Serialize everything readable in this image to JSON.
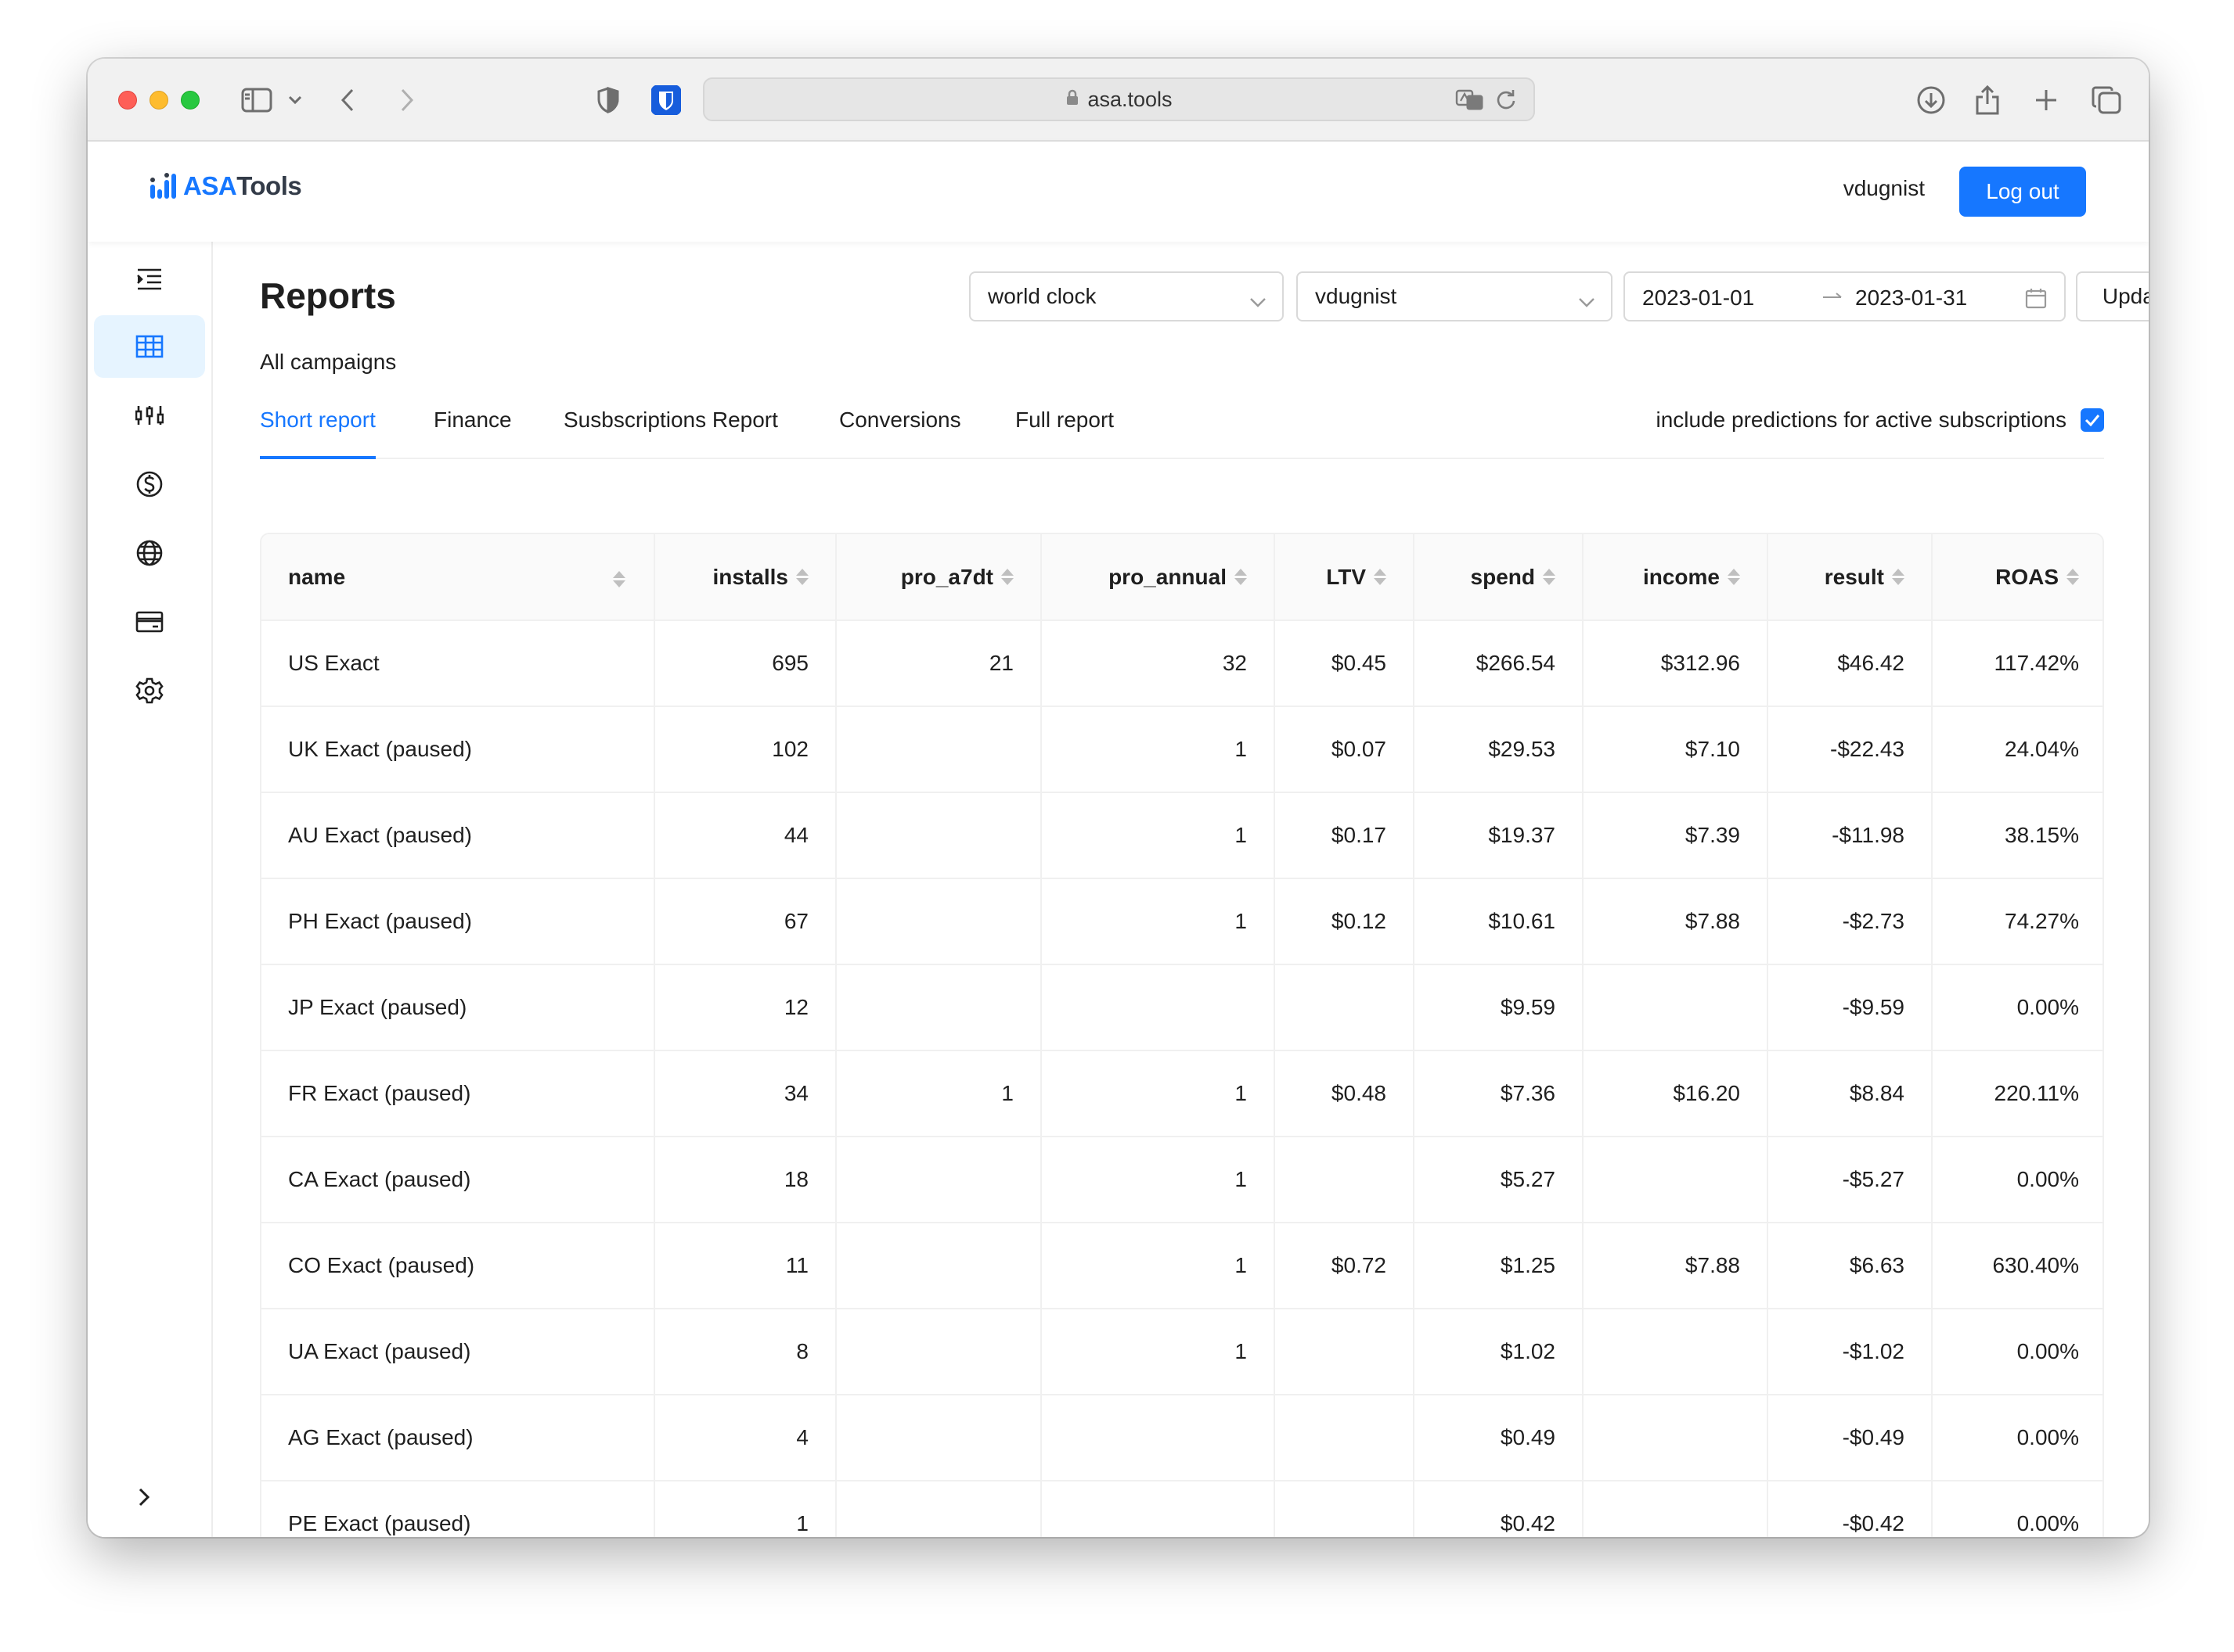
{
  "browser": {
    "url": "asa.tools"
  },
  "header": {
    "logo_part1": "ASA",
    "logo_part2": "Tools",
    "username": "vdugnist",
    "logout_label": "Log out"
  },
  "sidebar": {
    "items": [
      {
        "icon": "menu-fold-icon",
        "active": false
      },
      {
        "icon": "table-icon",
        "active": true
      },
      {
        "icon": "sliders-icon",
        "active": false
      },
      {
        "icon": "dollar-icon",
        "active": false
      },
      {
        "icon": "globe-icon",
        "active": false
      },
      {
        "icon": "credit-card-icon",
        "active": false
      },
      {
        "icon": "gear-icon",
        "active": false
      }
    ],
    "collapse_icon": "chevron-right-icon"
  },
  "page": {
    "title": "Reports",
    "subtitle": "All campaigns"
  },
  "filters": {
    "app_select": "world clock",
    "account_select": "vdugnist",
    "date_start": "2023-01-01",
    "date_end": "2023-01-31",
    "update_label": "Update"
  },
  "tabs": [
    {
      "label": "Short report",
      "active": true
    },
    {
      "label": "Finance",
      "active": false
    },
    {
      "label": "Susbscriptions Report",
      "active": false
    },
    {
      "label": "Conversions",
      "active": false
    },
    {
      "label": "Full report",
      "active": false
    }
  ],
  "predictions_label": "include predictions for active subscriptions",
  "predictions_checked": true,
  "table": {
    "columns": [
      "name",
      "installs",
      "pro_a7dt",
      "pro_annual",
      "LTV",
      "spend",
      "income",
      "result",
      "ROAS"
    ],
    "rows": [
      [
        "US Exact",
        "695",
        "21",
        "32",
        "$0.45",
        "$266.54",
        "$312.96",
        "$46.42",
        "117.42%"
      ],
      [
        "UK Exact (paused)",
        "102",
        "",
        "1",
        "$0.07",
        "$29.53",
        "$7.10",
        "-$22.43",
        "24.04%"
      ],
      [
        "AU Exact (paused)",
        "44",
        "",
        "1",
        "$0.17",
        "$19.37",
        "$7.39",
        "-$11.98",
        "38.15%"
      ],
      [
        "PH Exact (paused)",
        "67",
        "",
        "1",
        "$0.12",
        "$10.61",
        "$7.88",
        "-$2.73",
        "74.27%"
      ],
      [
        "JP Exact (paused)",
        "12",
        "",
        "",
        "",
        "$9.59",
        "",
        "-$9.59",
        "0.00%"
      ],
      [
        "FR Exact (paused)",
        "34",
        "1",
        "1",
        "$0.48",
        "$7.36",
        "$16.20",
        "$8.84",
        "220.11%"
      ],
      [
        "CA Exact (paused)",
        "18",
        "",
        "1",
        "",
        "$5.27",
        "",
        "-$5.27",
        "0.00%"
      ],
      [
        "CO Exact (paused)",
        "11",
        "",
        "1",
        "$0.72",
        "$1.25",
        "$7.88",
        "$6.63",
        "630.40%"
      ],
      [
        "UA Exact (paused)",
        "8",
        "",
        "1",
        "",
        "$1.02",
        "",
        "-$1.02",
        "0.00%"
      ],
      [
        "AG Exact (paused)",
        "4",
        "",
        "",
        "",
        "$0.49",
        "",
        "-$0.49",
        "0.00%"
      ],
      [
        "PE Exact (paused)",
        "1",
        "",
        "",
        "",
        "$0.42",
        "",
        "-$0.42",
        "0.00%"
      ],
      [
        "",
        "",
        "",
        "",
        "",
        "",
        "",
        "",
        ""
      ]
    ]
  },
  "colors": {
    "accent": "#1677ff",
    "header_bg": "#fafafa",
    "border": "#f0f0f0"
  }
}
